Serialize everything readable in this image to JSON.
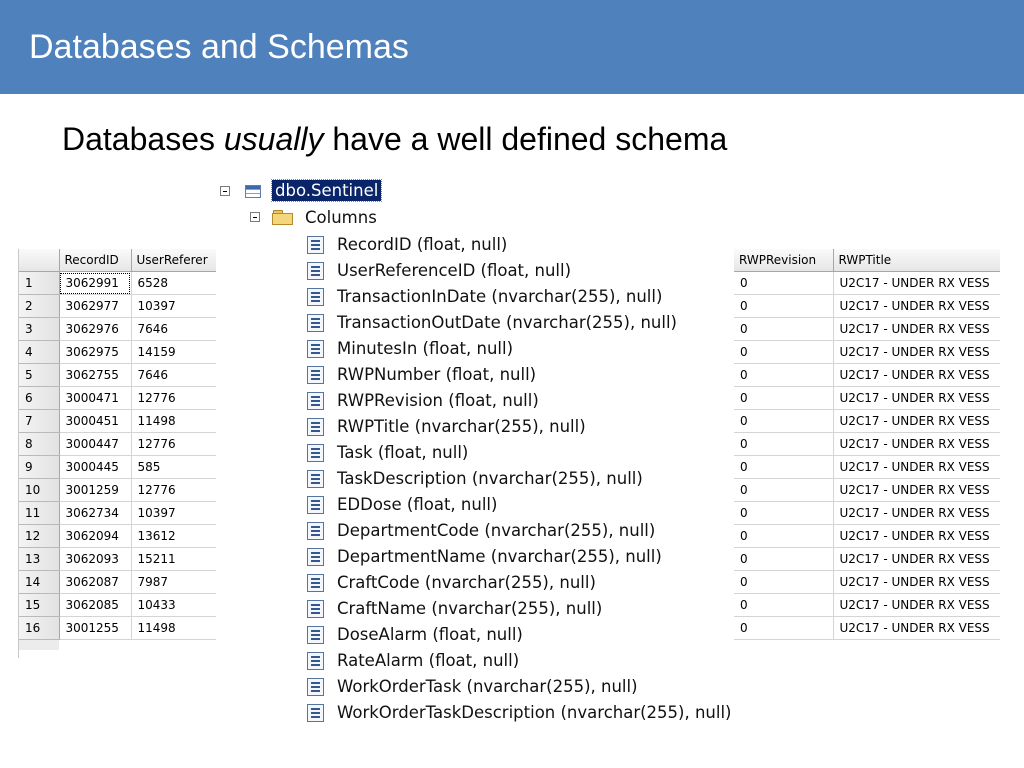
{
  "slide": {
    "title": "Databases and Schemas",
    "subtitle_before": "Databases ",
    "subtitle_emphasis": "usually",
    "subtitle_after": " have a well defined schema"
  },
  "tree": {
    "root_label": "dbo.Sentinel",
    "folder_label": "Columns",
    "columns": [
      "RecordID (float, null)",
      "UserReferenceID (float, null)",
      "TransactionInDate (nvarchar(255), null)",
      "TransactionOutDate (nvarchar(255), null)",
      "MinutesIn (float, null)",
      "RWPNumber (float, null)",
      "RWPRevision (float, null)",
      "RWPTitle (nvarchar(255), null)",
      "Task (float, null)",
      "TaskDescription (nvarchar(255), null)",
      "EDDose (float, null)",
      "DepartmentCode (nvarchar(255), null)",
      "DepartmentName (nvarchar(255), null)",
      "CraftCode (nvarchar(255), null)",
      "CraftName (nvarchar(255), null)",
      "DoseAlarm (float, null)",
      "RateAlarm (float, null)",
      "WorkOrderTask (nvarchar(255), null)",
      "WorkOrderTaskDescription (nvarchar(255), null)"
    ]
  },
  "left_grid": {
    "headers": [
      "RecordID",
      "UserReferer"
    ],
    "rows": [
      [
        "1",
        "3062991",
        "6528"
      ],
      [
        "2",
        "3062977",
        "10397"
      ],
      [
        "3",
        "3062976",
        "7646"
      ],
      [
        "4",
        "3062975",
        "14159"
      ],
      [
        "5",
        "3062755",
        "7646"
      ],
      [
        "6",
        "3000471",
        "12776"
      ],
      [
        "7",
        "3000451",
        "11498"
      ],
      [
        "8",
        "3000447",
        "12776"
      ],
      [
        "9",
        "3000445",
        "585"
      ],
      [
        "10",
        "3001259",
        "12776"
      ],
      [
        "11",
        "3062734",
        "10397"
      ],
      [
        "12",
        "3062094",
        "13612"
      ],
      [
        "13",
        "3062093",
        "15211"
      ],
      [
        "14",
        "3062087",
        "7987"
      ],
      [
        "15",
        "3062085",
        "10433"
      ],
      [
        "16",
        "3001255",
        "11498"
      ]
    ]
  },
  "right_grid": {
    "headers": [
      "RWPRevision",
      "RWPTitle"
    ],
    "rows": [
      [
        "0",
        "U2C17 - UNDER RX VESS"
      ],
      [
        "0",
        "U2C17 - UNDER RX VESS"
      ],
      [
        "0",
        "U2C17 - UNDER RX VESS"
      ],
      [
        "0",
        "U2C17 - UNDER RX VESS"
      ],
      [
        "0",
        "U2C17 - UNDER RX VESS"
      ],
      [
        "0",
        "U2C17 - UNDER RX VESS"
      ],
      [
        "0",
        "U2C17 - UNDER RX VESS"
      ],
      [
        "0",
        "U2C17 - UNDER RX VESS"
      ],
      [
        "0",
        "U2C17 - UNDER RX VESS"
      ],
      [
        "0",
        "U2C17 - UNDER RX VESS"
      ],
      [
        "0",
        "U2C17 - UNDER RX VESS"
      ],
      [
        "0",
        "U2C17 - UNDER RX VESS"
      ],
      [
        "0",
        "U2C17 - UNDER RX VESS"
      ],
      [
        "0",
        "U2C17 - UNDER RX VESS"
      ],
      [
        "0",
        "U2C17 - UNDER RX VESS"
      ],
      [
        "0",
        "U2C17 - UNDER RX VESS"
      ]
    ]
  },
  "colors": {
    "banner": "#4f81bd",
    "selection": "#0a246a"
  },
  "icons": {
    "root": "table-icon",
    "folder": "folder-icon",
    "column": "column-icon",
    "expander": "collapse-icon"
  }
}
